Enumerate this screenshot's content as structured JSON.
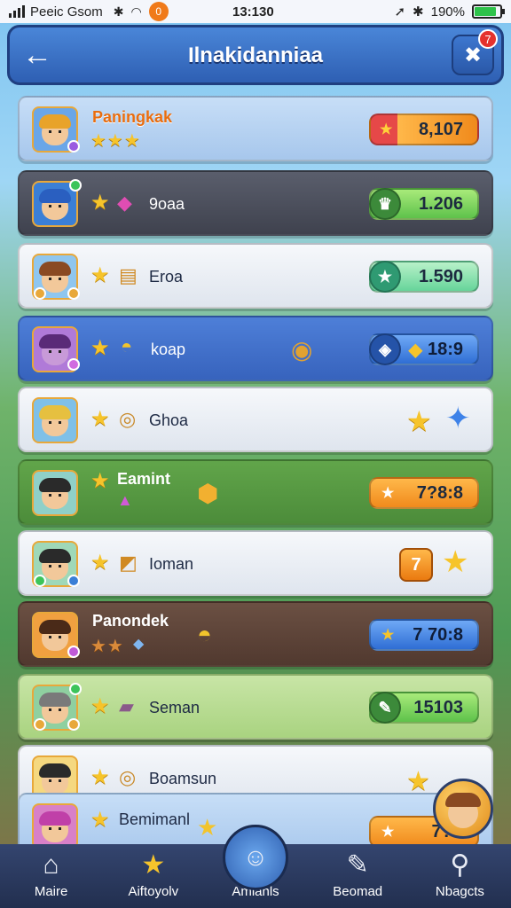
{
  "status_bar": {
    "carrier": "Peeic Gsom",
    "time": "13:130",
    "battery": "190%",
    "notification_count": "0"
  },
  "header": {
    "title": "Ilnakidanniaa",
    "menu_badge": "7"
  },
  "rows": [
    {
      "name": "Paningkak",
      "value": "8,107",
      "theme": "t-blue",
      "pill": "red-orange"
    },
    {
      "name": "9oaa",
      "value": "1.206",
      "theme": "t-dark",
      "pill": "green"
    },
    {
      "name": "Eroa",
      "value": "1.590",
      "theme": "t-light",
      "pill": "mint"
    },
    {
      "name": "koap",
      "value": "18:9",
      "theme": "t-royal",
      "pill": "blue"
    },
    {
      "name": "Ghoa",
      "value": "",
      "theme": "t-light",
      "pill": "none"
    },
    {
      "name": "Eamint",
      "value": "7?8:8",
      "theme": "t-green",
      "pill": "orange"
    },
    {
      "name": "Ioman",
      "value": "7",
      "theme": "t-light",
      "pill": "square"
    },
    {
      "name": "Panondek",
      "value": "7 70:8",
      "theme": "t-brown",
      "pill": "blue"
    },
    {
      "name": "Seman",
      "value": "15103",
      "theme": "t-lime",
      "pill": "green"
    },
    {
      "name": "Boamsun",
      "value": "",
      "theme": "t-light",
      "pill": "none"
    },
    {
      "name": "Bemimanl",
      "value": "7??",
      "theme": "t-blue",
      "pill": "orange"
    }
  ],
  "nav": {
    "items": [
      {
        "label": "Maire",
        "icon": "home-icon"
      },
      {
        "label": "Aiftoyolv",
        "icon": "star-icon"
      },
      {
        "label": "Amlanls",
        "icon": "avatar-icon"
      },
      {
        "label": "Beomad",
        "icon": "edit-icon"
      },
      {
        "label": "Nbagcts",
        "icon": "search-icon"
      }
    ]
  },
  "colors": {
    "header": "#3a6fc6",
    "accent_orange": "#f08a1c",
    "nav": "#2a3a5e"
  }
}
